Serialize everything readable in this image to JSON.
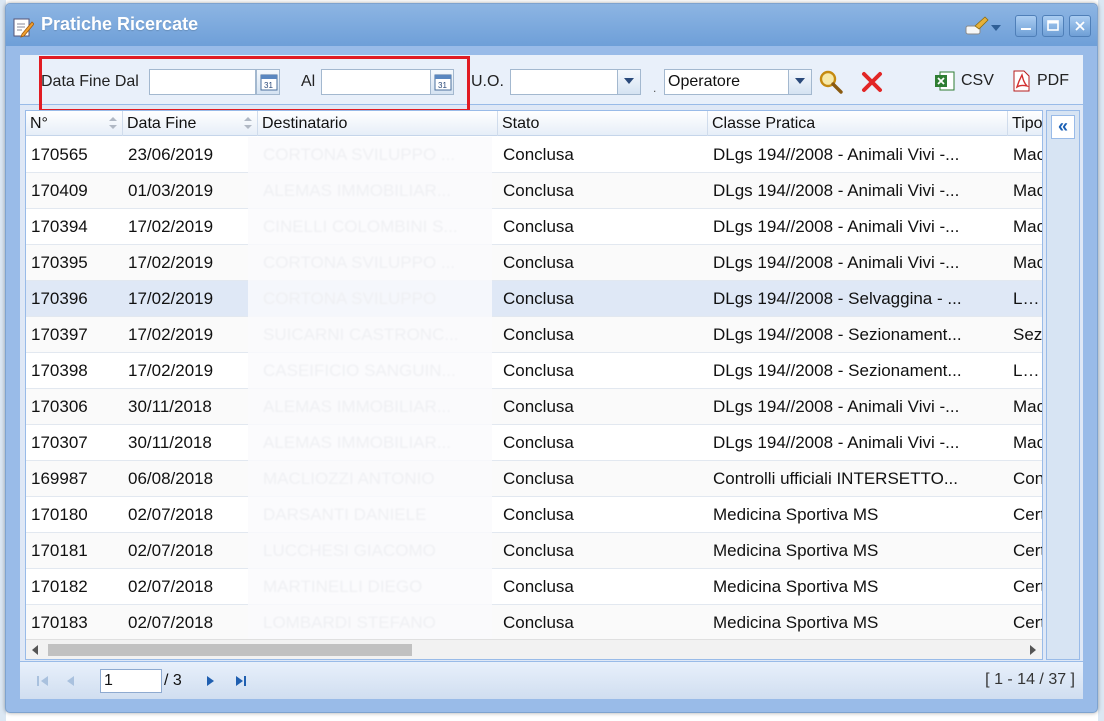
{
  "window": {
    "title": "Pratiche Ricercate"
  },
  "filters": {
    "date_from_label": "Data Fine Dal",
    "date_from_value": "",
    "date_to_label": "Al",
    "date_to_value": "",
    "uo_label": "U.O.",
    "uo_value": "",
    "operator_value": "Operatore"
  },
  "exports": {
    "csv_label": "CSV",
    "pdf_label": "PDF"
  },
  "columns": [
    "N°",
    "Data Fine",
    "Destinatario",
    "Stato",
    "Classe Pratica",
    "Tipo"
  ],
  "rows": [
    {
      "n": "170565",
      "date": "23/06/2019",
      "recipient": "CORTONA SVILUPPO ...",
      "status": "Conclusa",
      "class": "DLgs 194//2008 - Animali Vivi -...",
      "type": "Mac"
    },
    {
      "n": "170409",
      "date": "01/03/2019",
      "recipient": "ALEMAS IMMOBILIAR...",
      "status": "Conclusa",
      "class": "DLgs 194//2008 - Animali Vivi -...",
      "type": "Mac"
    },
    {
      "n": "170394",
      "date": "17/02/2019",
      "recipient": "CINELLI COLOMBINI S...",
      "status": "Conclusa",
      "class": "DLgs 194//2008 - Animali Vivi -...",
      "type": "Mac"
    },
    {
      "n": "170395",
      "date": "17/02/2019",
      "recipient": "CORTONA SVILUPPO ...",
      "status": "Conclusa",
      "class": "DLgs 194//2008 - Animali Vivi -...",
      "type": "Mac"
    },
    {
      "n": "170396",
      "date": "17/02/2019",
      "recipient": "CORTONA SVILUPPO",
      "status": "Conclusa",
      "class": "DLgs 194//2008 - Selvaggina - ...",
      "type": "Lavo"
    },
    {
      "n": "170397",
      "date": "17/02/2019",
      "recipient": "SUICARNI CASTRONC...",
      "status": "Conclusa",
      "class": "DLgs 194//2008 - Sezionament...",
      "type": "Sezi"
    },
    {
      "n": "170398",
      "date": "17/02/2019",
      "recipient": "CASEIFICIO SANGUIN...",
      "status": "Conclusa",
      "class": "DLgs 194//2008 - Sezionament...",
      "type": "Lavo"
    },
    {
      "n": "170306",
      "date": "30/11/2018",
      "recipient": "ALEMAS IMMOBILIAR...",
      "status": "Conclusa",
      "class": "DLgs 194//2008 - Animali Vivi -...",
      "type": "Mac"
    },
    {
      "n": "170307",
      "date": "30/11/2018",
      "recipient": "ALEMAS IMMOBILIAR...",
      "status": "Conclusa",
      "class": "DLgs 194//2008 - Animali Vivi -...",
      "type": "Mac"
    },
    {
      "n": "169987",
      "date": "06/08/2018",
      "recipient": "MACLIOZZI ANTONIO",
      "status": "Conclusa",
      "class": "Controlli ufficiali INTERSETTO...",
      "type": "Con"
    },
    {
      "n": "170180",
      "date": "02/07/2018",
      "recipient": "DARSANTI DANIELE",
      "status": "Conclusa",
      "class": "Medicina Sportiva MS",
      "type": "Cert"
    },
    {
      "n": "170181",
      "date": "02/07/2018",
      "recipient": "LUCCHESI GIACOMO",
      "status": "Conclusa",
      "class": "Medicina Sportiva MS",
      "type": "Cert"
    },
    {
      "n": "170182",
      "date": "02/07/2018",
      "recipient": "MARTINELLI DIEGO",
      "status": "Conclusa",
      "class": "Medicina Sportiva MS",
      "type": "Cert"
    },
    {
      "n": "170183",
      "date": "02/07/2018",
      "recipient": "LOMBARDI STEFANO",
      "status": "Conclusa",
      "class": "Medicina Sportiva MS",
      "type": "Cert"
    }
  ],
  "selected_row": 4,
  "pager": {
    "page": "1",
    "of": "/ 3",
    "info": "[ 1 - 14 / 37 ]"
  },
  "colors": {
    "accent": "#99bbe8",
    "title_bar": "#7aa7dc",
    "highlight": "#e11b22",
    "selected_row": "#dfe8f6"
  }
}
